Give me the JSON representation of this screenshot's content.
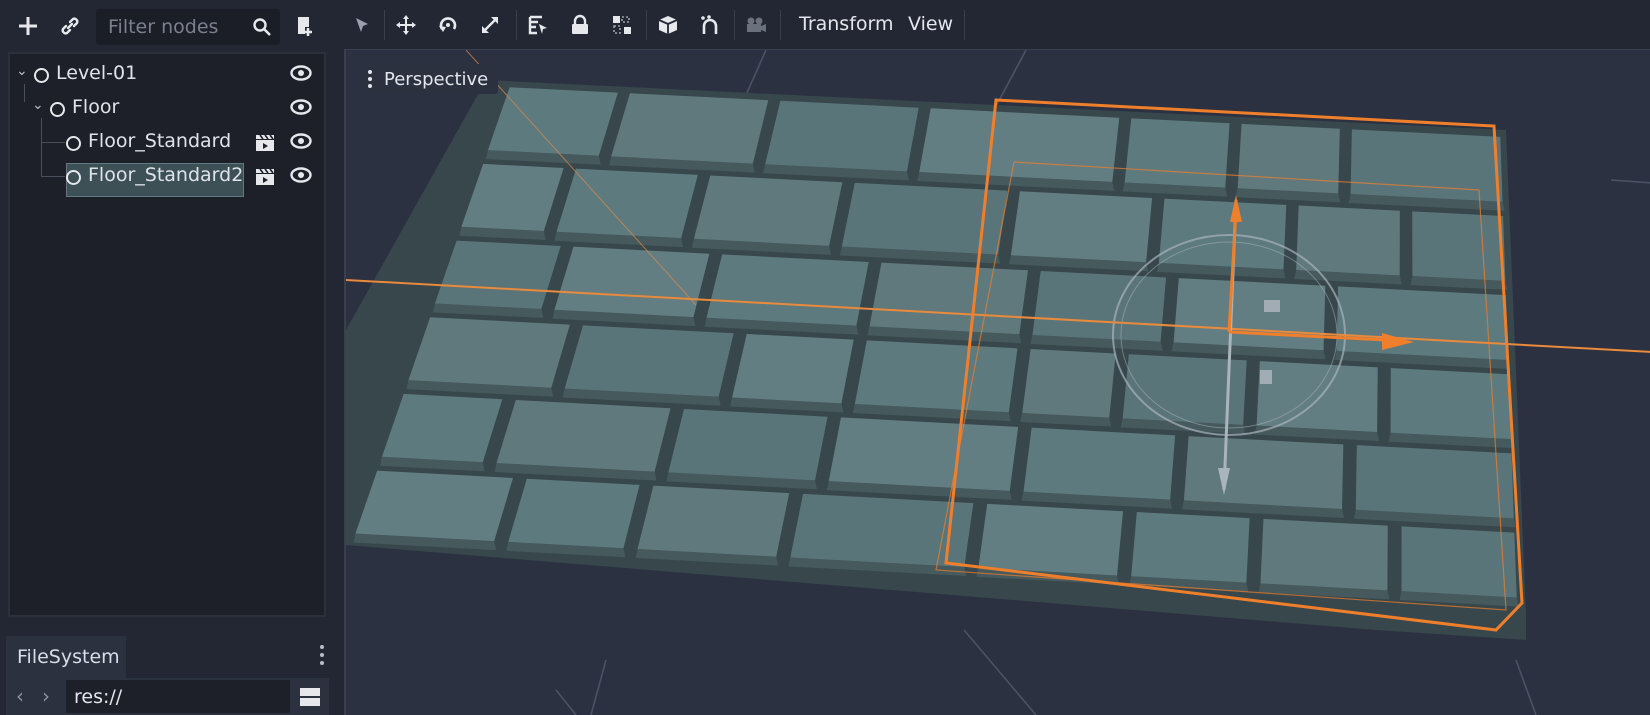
{
  "scene_dock": {
    "filter": {
      "placeholder": "Filter nodes",
      "value": ""
    },
    "tree": [
      {
        "label": "Level-01",
        "depth": 0,
        "expanded": true,
        "visible": true,
        "scene_instance": false
      },
      {
        "label": "Floor",
        "depth": 1,
        "expanded": true,
        "visible": true,
        "scene_instance": false
      },
      {
        "label": "Floor_Standard",
        "depth": 2,
        "visible": true,
        "scene_instance": true
      },
      {
        "label": "Floor_Standard2",
        "depth": 2,
        "visible": true,
        "scene_instance": true,
        "selected": true
      }
    ],
    "icons": {
      "add": "plus-icon",
      "instance": "link-icon",
      "search": "search-icon",
      "script": "attach-script-icon",
      "node": "node-circle-icon",
      "visibility": "eye-icon",
      "scene": "clapperboard-icon"
    }
  },
  "filesystem_dock": {
    "tab_label": "FileSystem",
    "path": "res://",
    "icons": {
      "back": "chevron-left-icon",
      "forward": "chevron-right-icon",
      "menu": "kebab-menu-icon",
      "layout": "split-view-icon"
    }
  },
  "viewport_toolbar": {
    "tools": [
      "select-icon",
      "move-icon",
      "rotate-icon",
      "scale-icon",
      "list-select-icon",
      "lock-icon",
      "group-icon",
      "local-space-icon",
      "snap-icon",
      "camera-icon"
    ],
    "menus": [
      "Transform",
      "View"
    ]
  },
  "viewport": {
    "perspective_label": "Perspective",
    "colors": {
      "background": "#2b3140",
      "tile": "#5e7b7f",
      "selection": "#f07f2c",
      "grid": "#4a5163"
    }
  }
}
